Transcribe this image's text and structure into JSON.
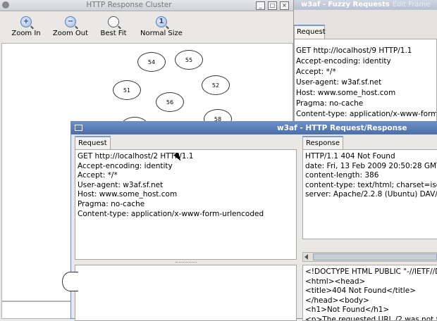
{
  "fuzzy_window": {
    "title": "w3af - Fuzzy Requests",
    "title_ghost": "Edit Frame",
    "tab_request": "Request",
    "request_lines": [
      "GET http://localhost/9 HTTP/1.1",
      "Accept-encoding: identity",
      "Accept: */*",
      "User-agent: w3af.sf.net",
      "Host: www.some_host.com",
      "Pragma: no-cache",
      "Content-type: application/x-www-form-urlencoded"
    ]
  },
  "cluster_window": {
    "title": "HTTP Response Cluster",
    "toolbar": {
      "zoom_in": "Zoom In",
      "zoom_out": "Zoom Out",
      "best_fit": "Best Fit",
      "normal_size": "Normal Size"
    },
    "nodes": [
      {
        "label": "54"
      },
      {
        "label": "55"
      },
      {
        "label": "51"
      },
      {
        "label": "52"
      },
      {
        "label": "56"
      },
      {
        "label": "58"
      }
    ]
  },
  "reqres_window": {
    "title": "w3af - HTTP Request/Response",
    "tab_request": "Request",
    "tab_response": "Response",
    "request_lines": [
      "GET http://localhost/2 HTTP/1.1",
      "Accept-encoding: identity",
      "Accept: */*",
      "User-agent: w3af.sf.net",
      "Host: www.some_host.com",
      "Pragma: no-cache",
      "Content-type: application/x-www-form-urlencoded"
    ],
    "response_header_lines": [
      "HTTP/1.1 404 Not Found",
      "date: Fri, 13 Feb 2009 20:50:28 GMT",
      "content-length: 386",
      "content-type: text/html; charset=iso",
      "server: Apache/2.2.8 (Ubuntu) DAV/2"
    ],
    "response_body_lines": [
      "<!DOCTYPE HTML PUBLIC \"-//IETF//D",
      "<html><head>",
      "<title>404 Not Found</title>",
      "</head><body>",
      "<h1>Not Found</h1>",
      "<p>The requested URL /2 was not f"
    ]
  }
}
